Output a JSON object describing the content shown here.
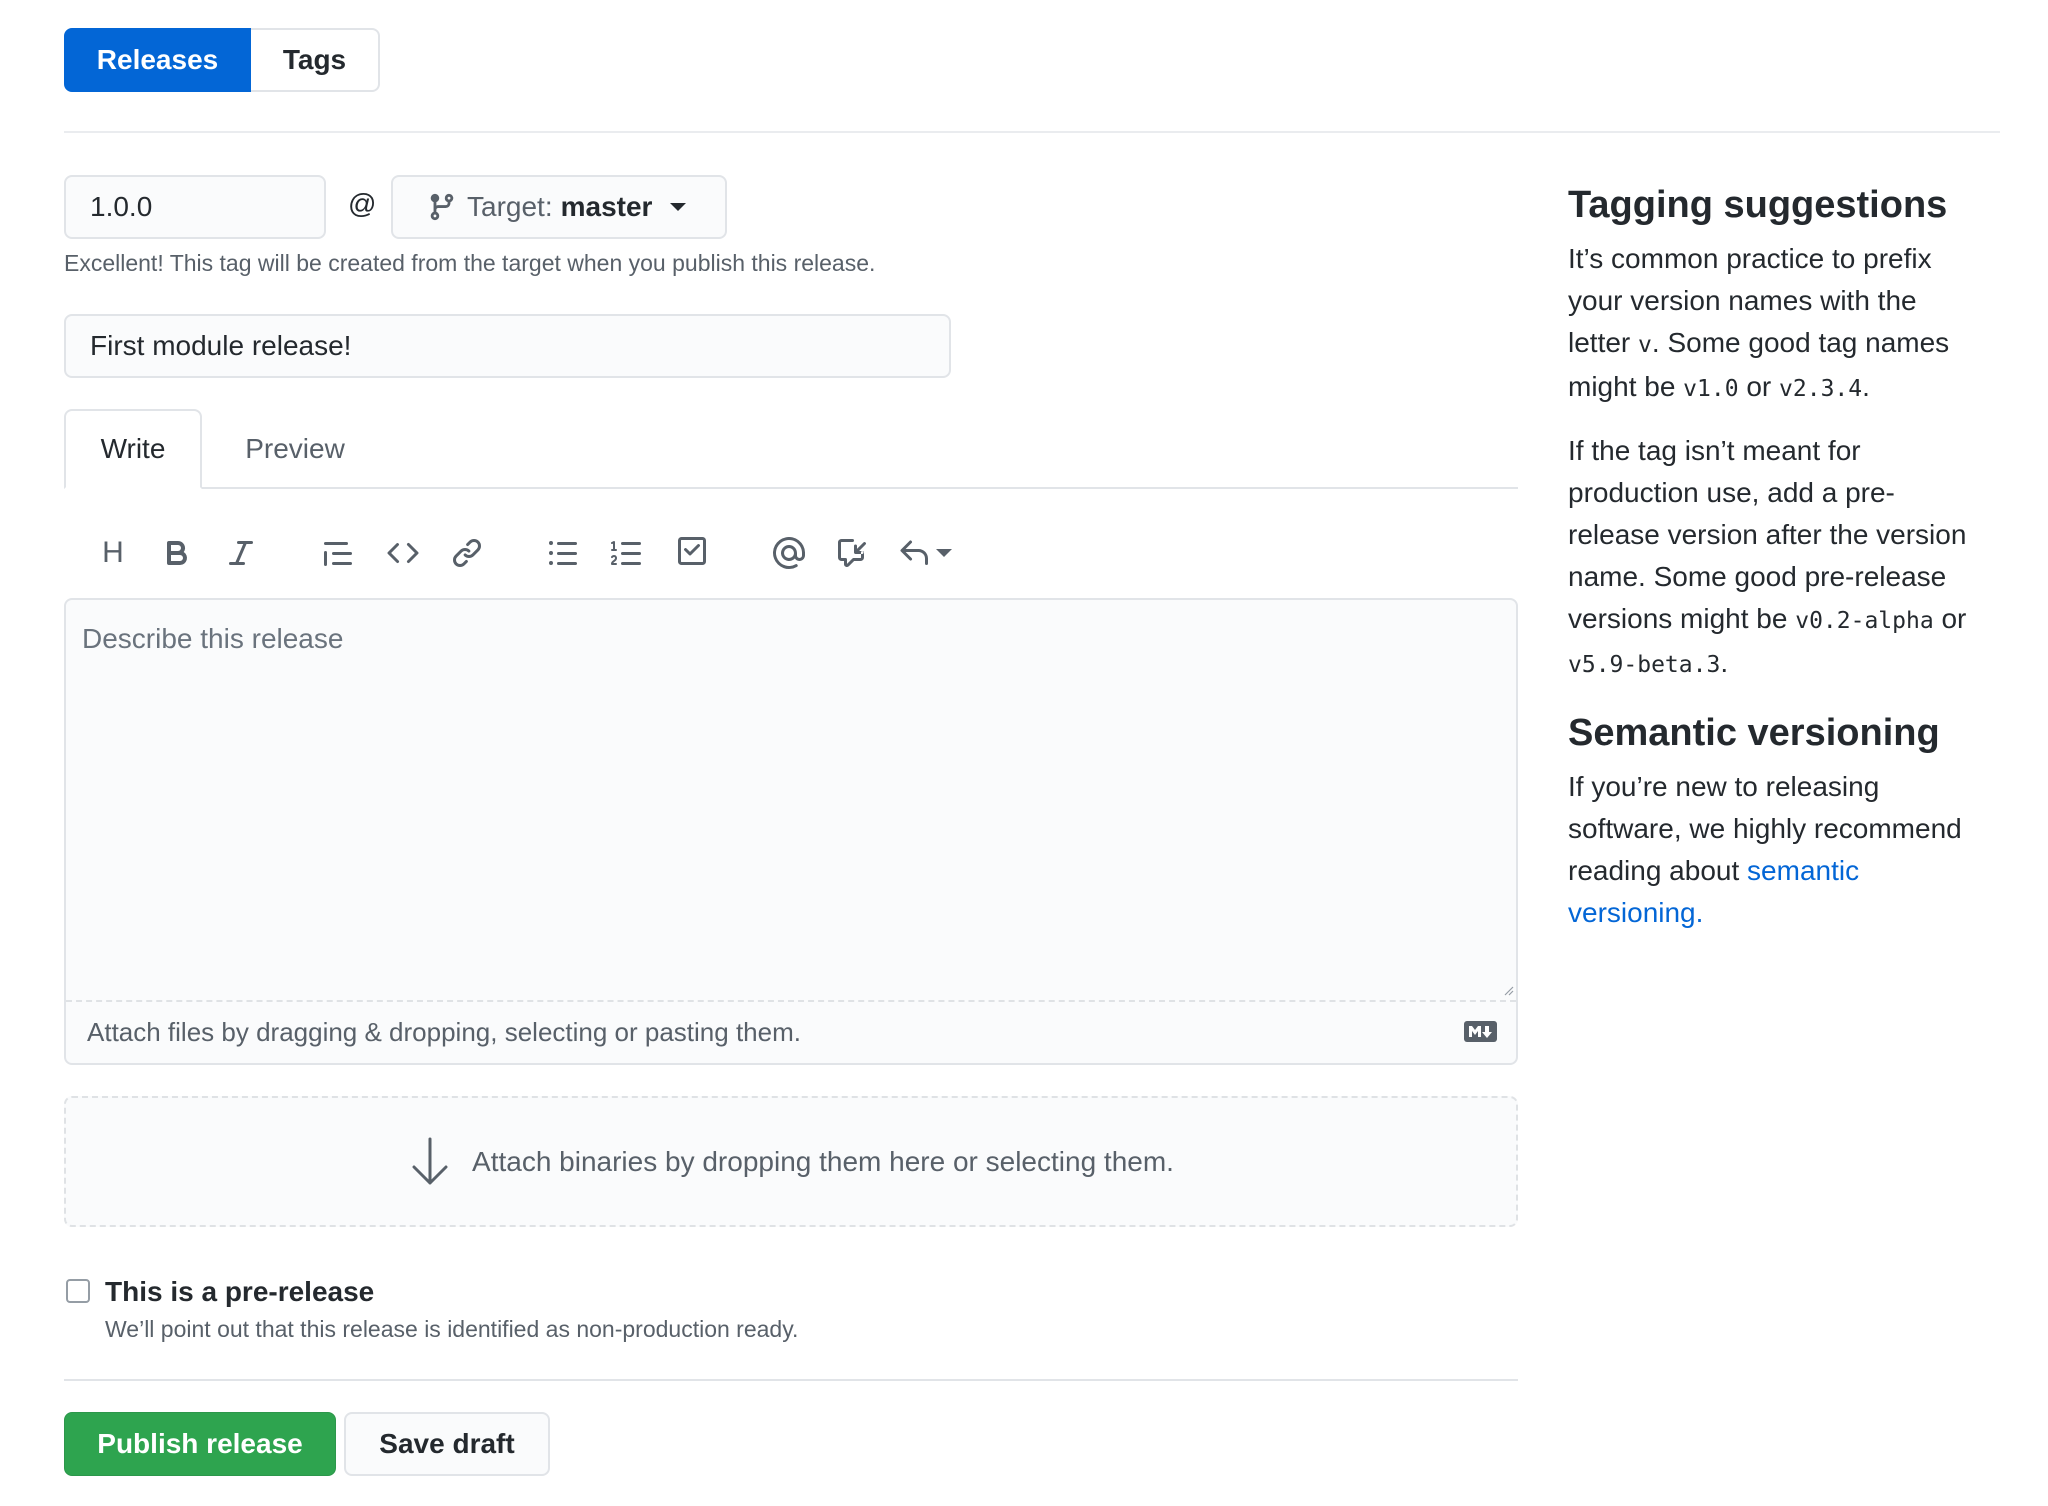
{
  "subnav": {
    "releases": "Releases",
    "tags": "Tags"
  },
  "tag": {
    "value": "1.0.0",
    "at": "@",
    "target_label": "Target:",
    "target_value": "master",
    "note": "Excellent! This tag will be created from the target when you publish this release."
  },
  "release_title": {
    "value": "First module release!"
  },
  "editor": {
    "tab_write": "Write",
    "tab_preview": "Preview",
    "toolbar": {
      "heading": "H",
      "icons": [
        "bold-icon",
        "italic-icon",
        "quote-icon",
        "code-icon",
        "link-icon",
        "bulleted-list-icon",
        "numbered-list-icon",
        "task-list-icon",
        "mention-icon",
        "reference-icon",
        "reply-icon"
      ]
    },
    "placeholder": "Describe this release",
    "attach_files": "Attach files by dragging & dropping, selecting or pasting them."
  },
  "binaries": {
    "text": "Attach binaries by dropping them here or selecting them."
  },
  "prerelease": {
    "label": "This is a pre-release",
    "note": "We’ll point out that this release is identified as non-production ready.",
    "checked": false
  },
  "actions": {
    "publish": "Publish release",
    "save_draft": "Save draft"
  },
  "sidebar": {
    "tagging_title": "Tagging suggestions",
    "tagging_p1": {
      "line1": "It’s common practice to prefix",
      "line2": "your version names with the",
      "line3_a": "letter ",
      "code_v": "v",
      "line3_b": ". Some good tag names",
      "line4_a": "might be ",
      "code_v1": "v1.0",
      "line4_b": " or ",
      "code_v2": "v2.3.4",
      "line4_c": "."
    },
    "tagging_p2": {
      "line1": "If the tag isn’t meant for",
      "line2": "production use, add a pre-",
      "line3": "release version after the version",
      "line4": "name. Some good pre-release",
      "line5_a": "versions might be ",
      "code_alpha": "v0.2-alpha",
      "line5_b": " or",
      "code_beta": "v5.9-beta.3",
      "line6_b": "."
    },
    "semver_title": "Semantic versioning",
    "semver_p": {
      "line1": "If you’re new to releasing",
      "line2": "software, we highly recommend",
      "line3_a": "reading about ",
      "link_a": "semantic",
      "link_b": "versioning."
    }
  },
  "colors": {
    "accent": "#0366d6",
    "publish": "#2ea44f",
    "text": "#24292e",
    "muted": "#586069"
  }
}
